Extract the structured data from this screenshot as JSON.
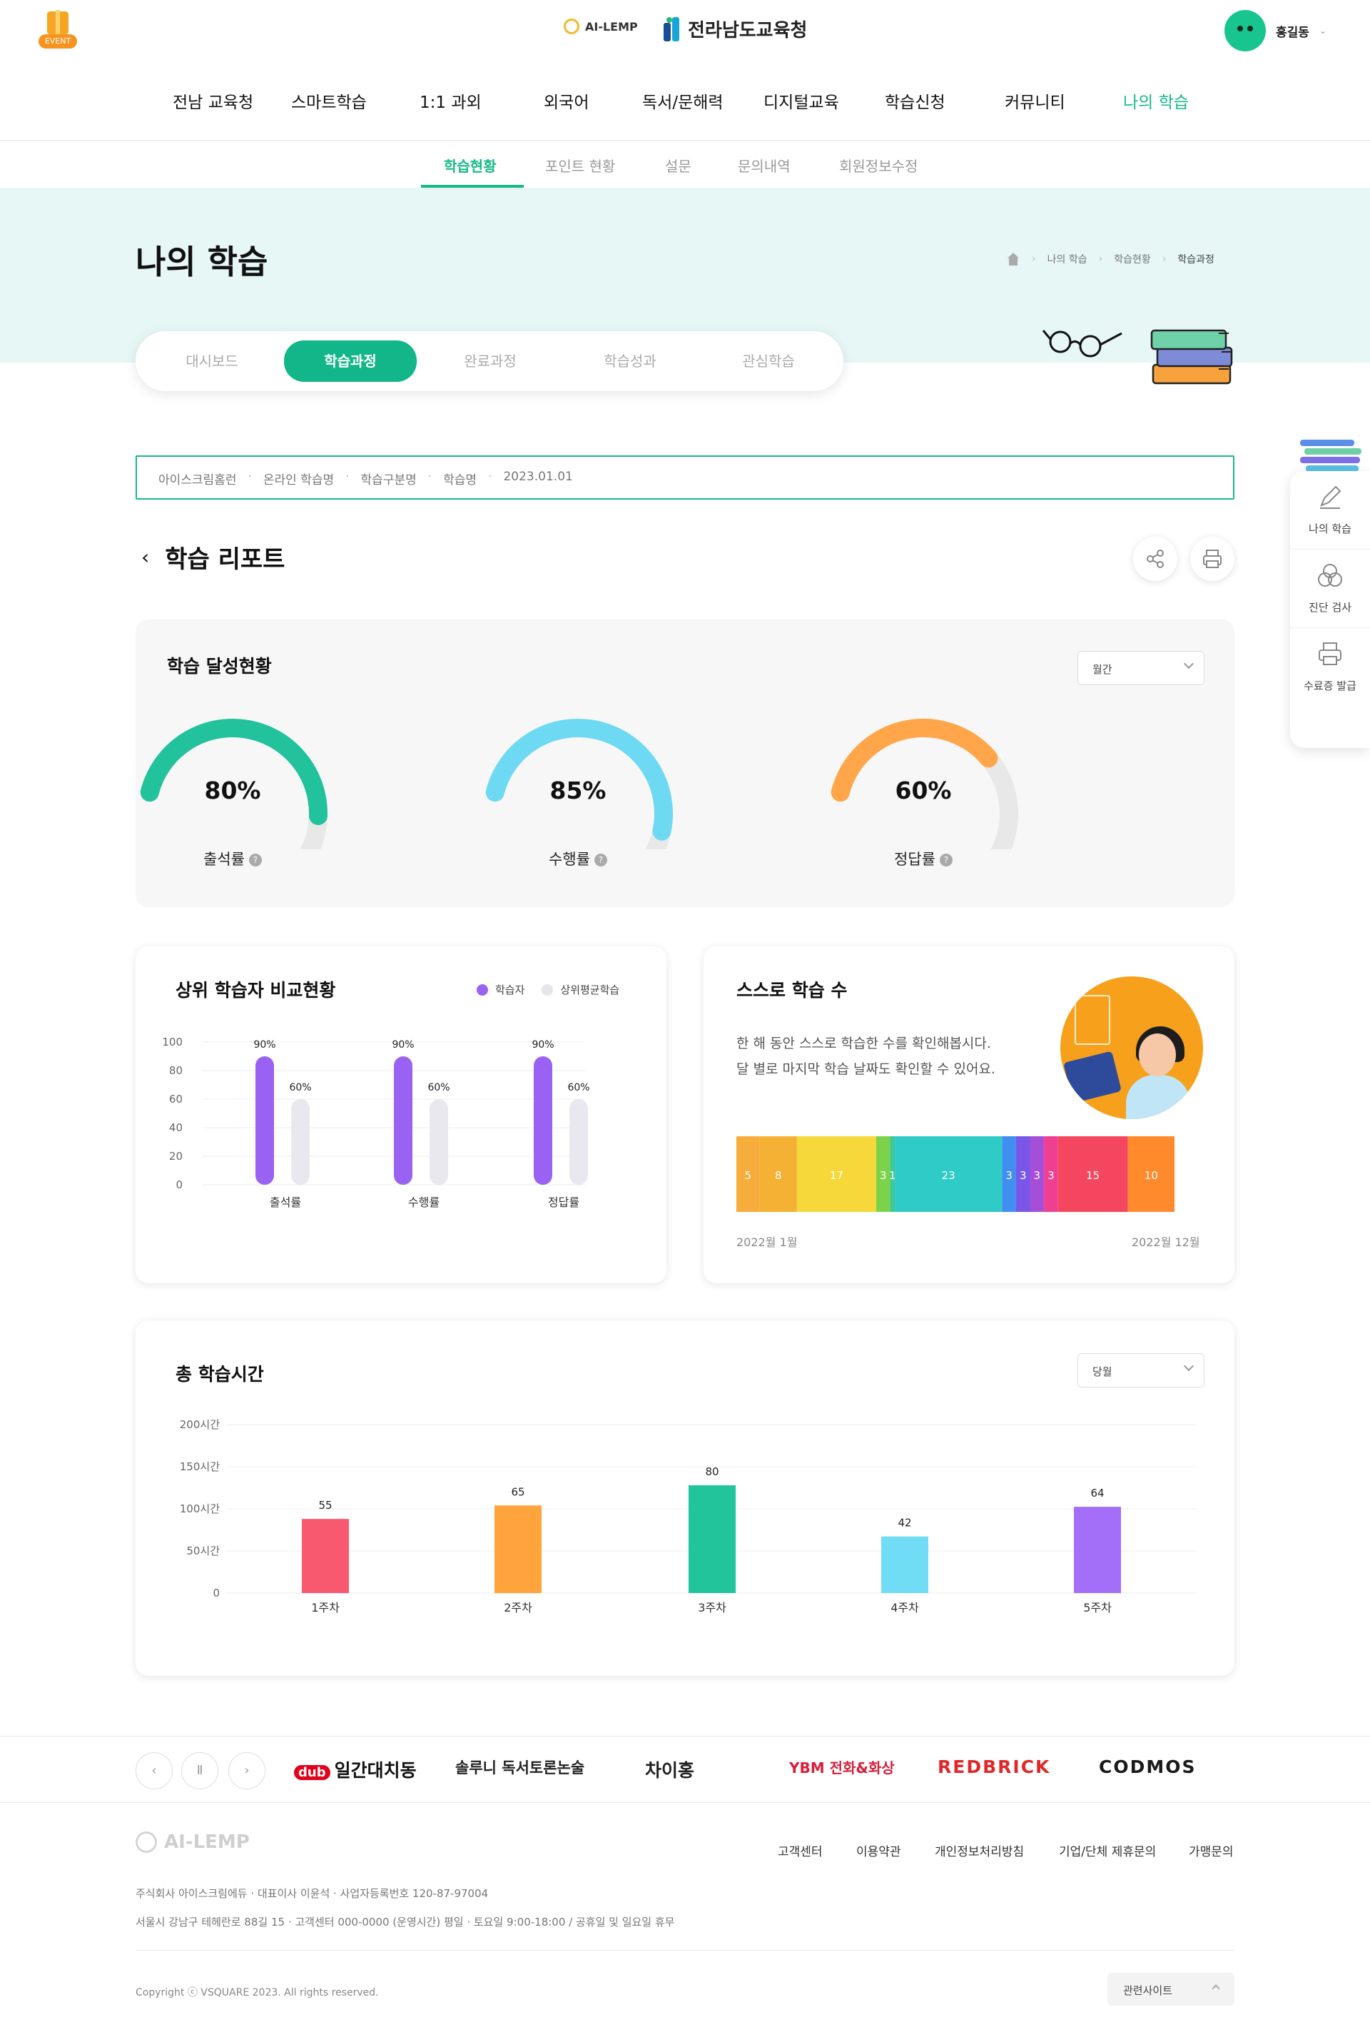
{
  "header": {
    "event_label": "EVENT",
    "logo_ai": "AI-LEMP",
    "logo_office": "전라남도교육청",
    "user_name": "홍길동",
    "gnb": [
      "전남 교육청",
      "스마트학습",
      "1:1 과외",
      "외국어",
      "독서/문해력",
      "디지털교육",
      "학습신청",
      "커뮤니티",
      "나의 학습"
    ],
    "gnb_active": 8
  },
  "subnav": {
    "items": [
      "학습현황",
      "포인트 현황",
      "설문",
      "문의내역",
      "회원정보수정"
    ],
    "active": 0
  },
  "hero": {
    "title": "나의 학습",
    "breadcrumb": [
      "나의 학습",
      "학습현황",
      "학습과정"
    ],
    "tabs": [
      "대시보드",
      "학습과정",
      "완료과정",
      "학습성과",
      "관심학습"
    ],
    "active_tab": 1
  },
  "quick_menu": [
    "나의 학습",
    "진단 검사",
    "수료증 발급"
  ],
  "filter": [
    "아이스크림홈런",
    "온라인 학습명",
    "학습구분명",
    "학습명",
    "2023.01.01"
  ],
  "report": {
    "title": "학습 리포트"
  },
  "achievement": {
    "title": "학습 달성현황",
    "period": "월간",
    "gauges": [
      {
        "label": "출석률",
        "value": "80%",
        "pct": 80,
        "color": "#21c29c"
      },
      {
        "label": "수행률",
        "value": "85%",
        "pct": 85,
        "color": "#6ed9f2"
      },
      {
        "label": "정답률",
        "value": "60%",
        "pct": 60,
        "color": "#ffa64a"
      }
    ]
  },
  "compare": {
    "title": "상위 학습자 비교현황",
    "legend": [
      "학습자",
      "상위평균학습"
    ],
    "colors": {
      "learner": "#9a62f2",
      "avg": "#e8e8ee"
    },
    "chart_data": {
      "type": "bar",
      "categories": [
        "출석률",
        "수행률",
        "정답률"
      ],
      "series": [
        {
          "name": "학습자",
          "values": [
            90,
            90,
            90
          ],
          "labels": [
            "90%",
            "90%",
            "90%"
          ]
        },
        {
          "name": "상위평균학습",
          "values": [
            60,
            60,
            60
          ],
          "labels": [
            "60%",
            "60%",
            "60%"
          ]
        }
      ],
      "yticks": [
        "100",
        "80",
        "60",
        "40",
        "20",
        "0"
      ],
      "ylim": [
        0,
        100
      ]
    }
  },
  "self_study": {
    "title": "스스로 학습 수",
    "desc": [
      "한 해 동안 스스로 학습한 수를 확인해봅시다.",
      "달 별로 마지막 학습 날짜도 확인할 수 있어요."
    ],
    "start_label": "2022월 1월",
    "end_label": "2022월 12월",
    "chart_data": {
      "type": "bar",
      "stacked": true,
      "values": [
        5,
        8,
        17,
        3,
        1,
        23,
        3,
        3,
        3,
        3,
        15,
        10
      ],
      "labels": [
        "5",
        "8",
        "17",
        "3",
        "1",
        "23",
        "3",
        "3",
        "3",
        "3",
        "15",
        "10"
      ],
      "colors": [
        "#f6ad3c",
        "#f5b133",
        "#f6d83a",
        "#7cd34a",
        "#3fc89a",
        "#2fcbc7",
        "#3f8ef0",
        "#7a56e8",
        "#a54fd9",
        "#ef3f91",
        "#f4475f",
        "#ff8a2b"
      ]
    }
  },
  "total_time": {
    "title": "총 학습시간",
    "period": "당월",
    "chart_data": {
      "type": "bar",
      "categories": [
        "1주차",
        "2주차",
        "3주차",
        "4주차",
        "5주차"
      ],
      "values": [
        55,
        65,
        80,
        42,
        64
      ],
      "labels": [
        "55",
        "65",
        "80",
        "42",
        "64"
      ],
      "colors": [
        "#f9596f",
        "#ffa43d",
        "#22c49b",
        "#70dcf5",
        "#a36ef8"
      ],
      "yticks": [
        "200시간",
        "150시간",
        "100시간",
        "50시간",
        "0"
      ],
      "ylim": [
        0,
        200
      ]
    }
  },
  "partners": [
    "일간대치동",
    "솔루니 독서토론논술",
    "차이홍",
    "YBM 전화&화상",
    "REDBRICK",
    "CODMOS"
  ],
  "footer": {
    "logo": "AI-LEMP",
    "links": [
      "고객센터",
      "이용약관",
      "개인정보처리방침",
      "기업/단체 제휴문의",
      "가맹문의"
    ],
    "info1": "주식회사 아이스크림에듀 · 대표이사 이윤석 · 사업자등록번호 120-87-97004",
    "info2": "서울시 강남구 테헤란로 88길 15 · 고객센터 000-0000 (운영시간) 평일 · 토요일 9:00-18:00 / 공휴일 및 일요일 휴무",
    "copyright": "Copyright ⓒ VSQUARE 2023. All rights reserved.",
    "related": "관련사이트"
  }
}
